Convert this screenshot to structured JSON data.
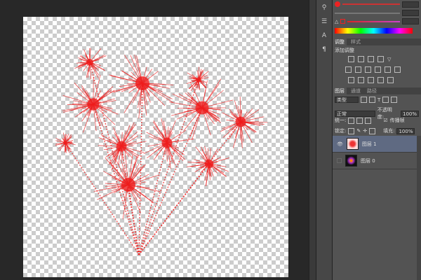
{
  "colors": {
    "firework": "#ee1c1c",
    "panel": "#535353",
    "background": "#282828",
    "selected_layer": "#5f6a82"
  },
  "adjustments": {
    "tabs": [
      "调整",
      "样式"
    ],
    "title": "添加调整"
  },
  "layers_panel": {
    "tabs": [
      "图层",
      "通道",
      "路径"
    ],
    "filter": "类型",
    "blend_mode": "正常",
    "opacity_label": "不透明度:",
    "opacity": "100%",
    "unify_label": "统一:",
    "propagate_label": "传播帧",
    "lock_label": "锁定:",
    "fill_label": "填充:",
    "fill": "100%",
    "layers": [
      {
        "name": "图层 1",
        "selected": true,
        "visible": true
      },
      {
        "name": "图层 0",
        "selected": false,
        "visible": false
      }
    ]
  }
}
